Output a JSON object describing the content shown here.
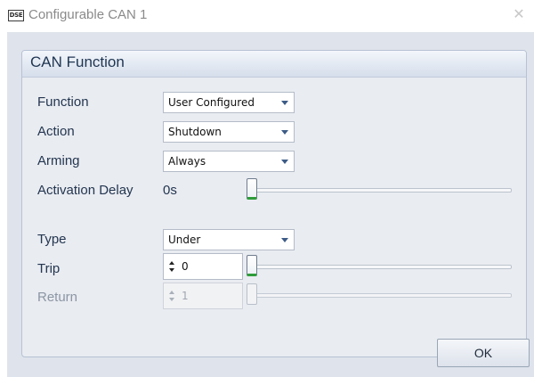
{
  "window": {
    "app_icon_text": "DSE",
    "title": "Configurable CAN 1"
  },
  "group": {
    "title": "CAN Function"
  },
  "fields": {
    "function": {
      "label": "Function",
      "value": "User Configured"
    },
    "action": {
      "label": "Action",
      "value": "Shutdown"
    },
    "arming": {
      "label": "Arming",
      "value": "Always"
    },
    "activation_delay": {
      "label": "Activation Delay",
      "value": "0s",
      "slider_fraction": 0.0
    },
    "type": {
      "label": "Type",
      "value": "Under"
    },
    "trip": {
      "label": "Trip",
      "value": "0",
      "slider_fraction": 0.0
    },
    "return": {
      "label": "Return",
      "value": "1",
      "slider_fraction": 0.0,
      "disabled": true
    }
  },
  "buttons": {
    "ok": "OK"
  },
  "icons": {
    "close": "close-icon",
    "dropdown": "chevron-down-icon",
    "spinner": "spin-arrows-icon"
  },
  "colors": {
    "slider_thumb_accent": "#2f9d3a",
    "title_text": "#1f3552",
    "panel_background": "#dfe3eb"
  }
}
